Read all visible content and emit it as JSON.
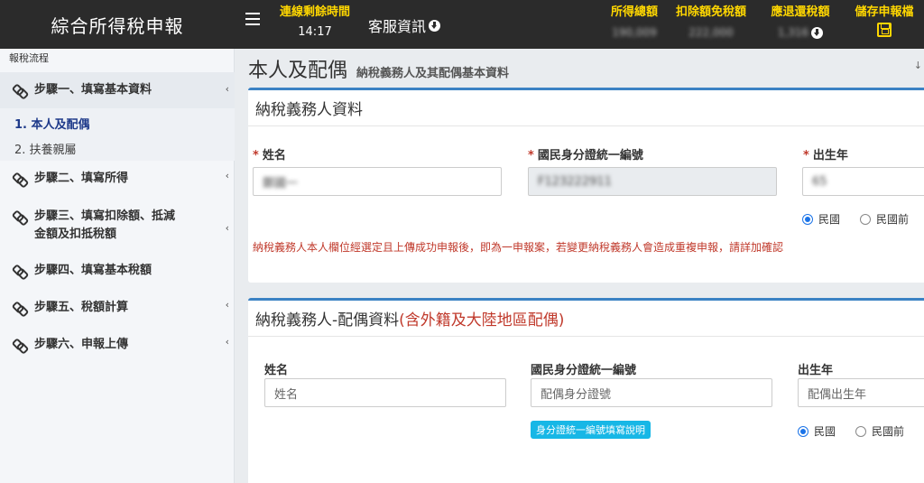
{
  "header": {
    "app_title": "綜合所得稅申報",
    "connection_label": "連線剩餘時間",
    "connection_time": "14:17",
    "support_label": "客服資訊",
    "total_income_label": "所得總額",
    "total_income_value": "190,009",
    "deduction_label": "扣除額免稅額",
    "deduction_value": "222,000",
    "refund_label": "應退還稅額",
    "refund_value": "1,316",
    "save_label": "儲存申報檔"
  },
  "sidebar": {
    "flow_label": "報稅流程",
    "steps": [
      {
        "label": "步驟一、填寫基本資料"
      },
      {
        "label": "步驟二、填寫所得"
      },
      {
        "label": "步驟三、填寫扣除額、抵減金額及扣抵稅額"
      },
      {
        "label": "步驟四、填寫基本稅額"
      },
      {
        "label": "步驟五、稅額計算"
      },
      {
        "label": "步驟六、申報上傳"
      }
    ],
    "sub_items": [
      {
        "label": "1. 本人及配偶"
      },
      {
        "label": "2. 扶養親屬"
      }
    ]
  },
  "main": {
    "title": "本人及配偶",
    "subtitle": "納稅義務人及其配偶基本資料",
    "taxpayer": {
      "heading": "納稅義務人資料",
      "name_label": "姓名",
      "name_value": "鄭國一",
      "id_label": "國民身分證統一編號",
      "id_value": "F123222911",
      "birth_label": "出生年",
      "birth_value": "65",
      "radio_roc": "民國",
      "radio_pre_roc": "民國前",
      "warning": "納稅義務人本人欄位經選定且上傳成功申報後，即為一申報案，若變更納稅義務人會造成重複申報，請詳加確認"
    },
    "spouse": {
      "heading": "納稅義務人-配偶資料",
      "heading_note": "(含外籍及大陸地區配偶)",
      "name_label": "姓名",
      "name_placeholder": "姓名",
      "id_label": "國民身分證統一編號",
      "id_placeholder": "配偶身分證號",
      "id_help_button": "身分證統一編號填寫說明",
      "birth_label": "出生年",
      "birth_placeholder": "配偶出生年",
      "radio_roc": "民國",
      "radio_pre_roc": "民國前"
    }
  }
}
